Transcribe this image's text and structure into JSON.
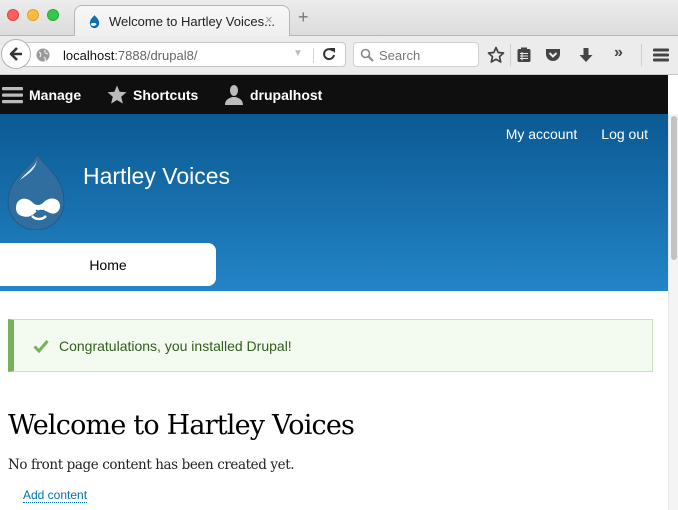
{
  "browser": {
    "tab": {
      "title": "Welcome to Hartley Voices...",
      "close_label": "×",
      "favicon": "drupal-drop-icon"
    },
    "new_tab_label": "+",
    "url": {
      "host": "localhost",
      "rest": ":7888/drupal8/"
    },
    "search": {
      "placeholder": "Search",
      "value": ""
    },
    "toolbar_icons": [
      "bookmark-star-icon",
      "reading-list-icon",
      "pocket-icon",
      "download-icon",
      "overflow-chevron-icon",
      "hamburger-menu-icon"
    ],
    "overflow_label": "»"
  },
  "drupal_toolbar": {
    "manage": "Manage",
    "shortcuts": "Shortcuts",
    "user": "drupalhost"
  },
  "header": {
    "secondary_menu": [
      {
        "label": "My account"
      },
      {
        "label": "Log out"
      }
    ],
    "site_name": "Hartley Voices",
    "primary_menu": [
      {
        "label": "Home",
        "active": true
      }
    ]
  },
  "message": {
    "type": "status",
    "text": "Congratulations, you installed Drupal!"
  },
  "main": {
    "title": "Welcome to Hartley Voices",
    "empty_text": "No front page content has been created yet.",
    "add_content_link": "Add content"
  },
  "colors": {
    "header_top": "#0b5a93",
    "header_bottom": "#2384c6",
    "toolbar_bg": "#0f0f0f",
    "message_border": "#77b259",
    "message_bg": "#f3faef",
    "link": "#0071b3"
  }
}
